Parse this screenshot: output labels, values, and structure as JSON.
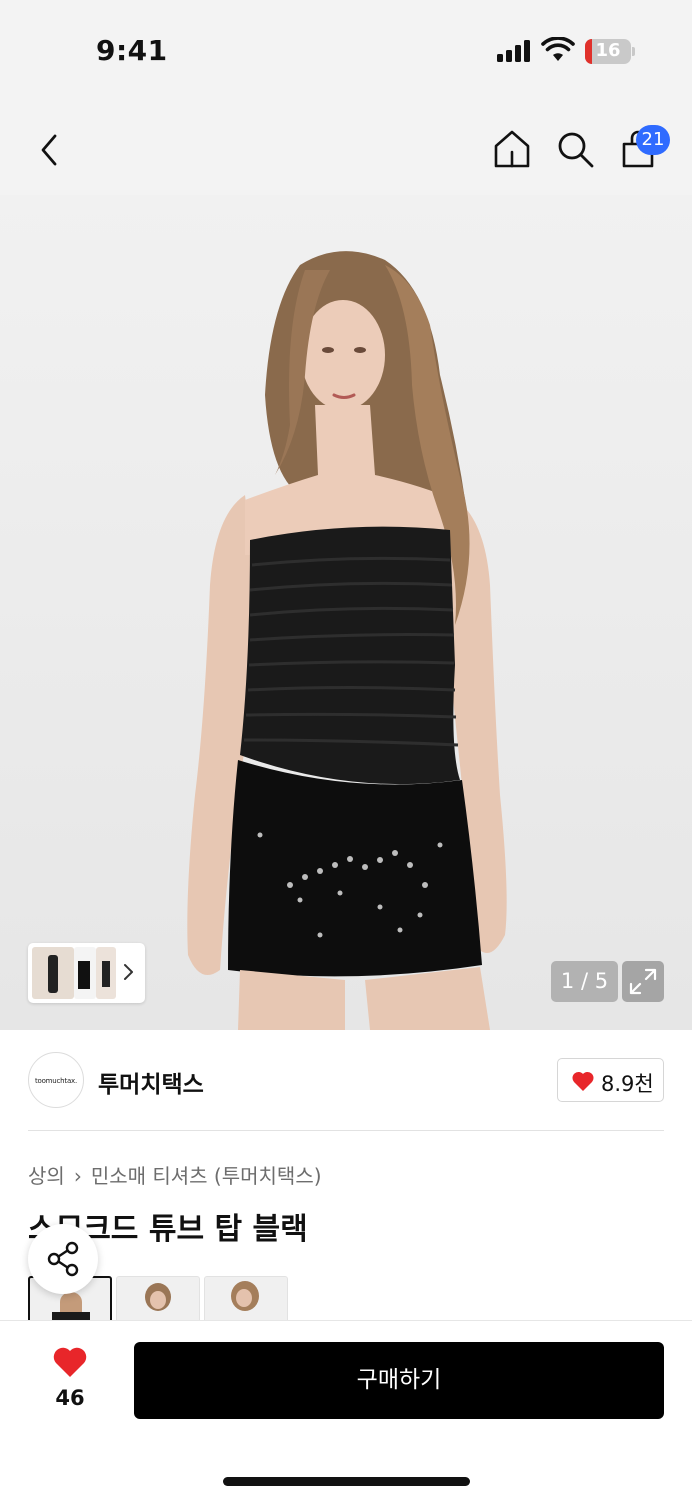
{
  "status_bar": {
    "time": "9:41",
    "battery_level": "16",
    "icons": [
      "signal-icon",
      "wifi-icon",
      "battery-icon"
    ]
  },
  "header": {
    "icons": [
      "back-icon",
      "home-icon",
      "search-icon",
      "shopping-bag-icon"
    ],
    "cart_count": "21"
  },
  "gallery": {
    "counter": "1 / 5",
    "current_index": 1,
    "total": 5,
    "icons": [
      "chevron-right-icon",
      "expand-icon"
    ]
  },
  "brand": {
    "logo_text": "toomuchtax.",
    "name": "투머치택스",
    "likes": "8.9천"
  },
  "breadcrumb": {
    "level1": "상의",
    "level2": "민소매 티셔츠 (투머치택스)"
  },
  "product": {
    "title": "스모크드 튜브 탑 블랙"
  },
  "bottom_bar": {
    "wishlist_count": "46",
    "buy_label": "구매하기"
  },
  "colors": {
    "accent_blue": "#2f6bff",
    "heart_red": "#e8262a",
    "buy_button": "#000000",
    "battery_red": "#e0312b"
  }
}
